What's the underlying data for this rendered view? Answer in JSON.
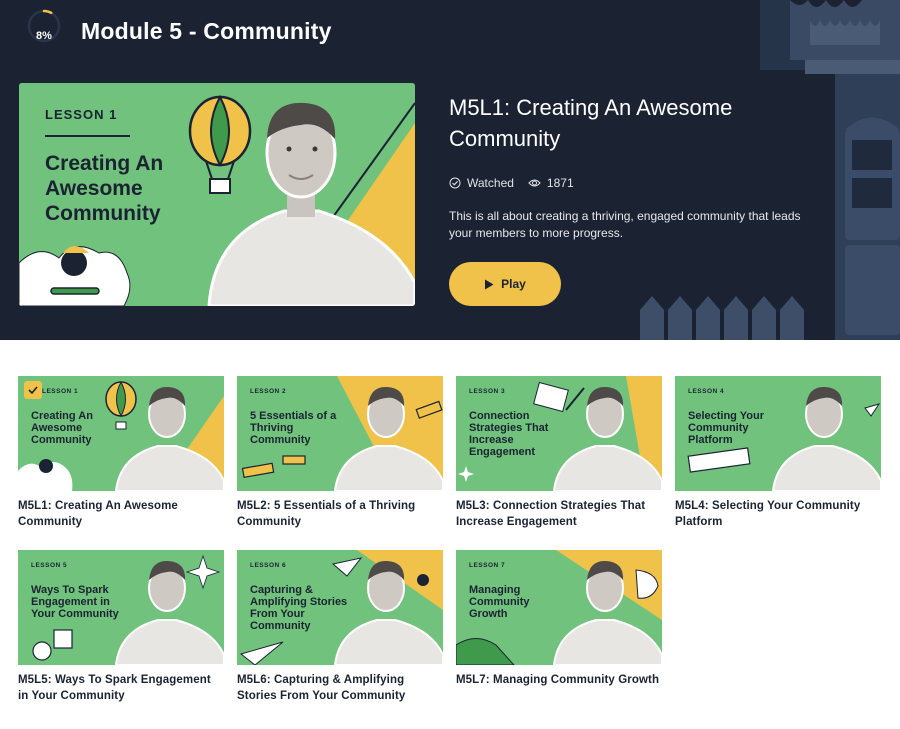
{
  "header": {
    "progress_label": "8%",
    "progress_value": 0.08,
    "module_title": "Module 5 - Community"
  },
  "featured": {
    "thumb": {
      "lesson_tag": "LESSON 1",
      "title": "Creating An Awesome Community"
    },
    "title": "M5L1: Creating An Awesome Community",
    "status": "Watched",
    "views": "1871",
    "description": "This is all about creating a thriving, engaged community that leads your members to more progress.",
    "play_label": "Play"
  },
  "lessons": [
    {
      "tag": "LESSON 1",
      "thumb_title": "Creating An Awesome Community",
      "label": "M5L1: Creating An Awesome Community",
      "watched": true
    },
    {
      "tag": "LESSON 2",
      "thumb_title": "5 Essentials of a Thriving Community",
      "label": "M5L2: 5 Essentials of a Thriving Community",
      "watched": false
    },
    {
      "tag": "LESSON 3",
      "thumb_title": "Connection Strategies That Increase Engagement",
      "label": "M5L3: Connection Strategies That Increase Engagement",
      "watched": false
    },
    {
      "tag": "LESSON 4",
      "thumb_title": "Selecting Your Community Platform",
      "label": "M5L4: Selecting Your Community Platform",
      "watched": false
    },
    {
      "tag": "LESSON 5",
      "thumb_title": "Ways To Spark Engagement in Your Community",
      "label": "M5L5: Ways To Spark Engagement in Your Community",
      "watched": false
    },
    {
      "tag": "LESSON 6",
      "thumb_title": "Capturing & Amplifying Stories From Your Community",
      "label": "M5L6: Capturing & Amplifying Stories From Your Community",
      "watched": false
    },
    {
      "tag": "LESSON 7",
      "thumb_title": "Managing Community Growth",
      "label": "M5L7: Managing Community Growth",
      "watched": false
    }
  ],
  "colors": {
    "hero_bg": "#1b2333",
    "accent": "#f0c24a",
    "thumb_green": "#71c27c"
  },
  "icons": {
    "watched": "check-circle-icon",
    "views": "eye-icon",
    "play": "play-icon"
  }
}
